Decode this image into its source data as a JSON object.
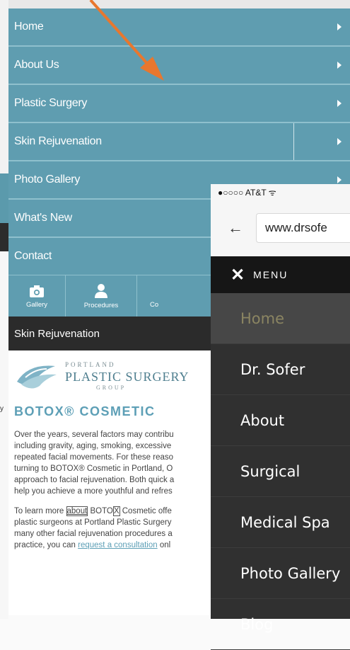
{
  "old_site": {
    "menu_items": [
      {
        "label": "Home"
      },
      {
        "label": "About Us"
      },
      {
        "label": "Plastic Surgery"
      },
      {
        "label": "Skin Rejuvenation"
      },
      {
        "label": "Photo Gallery"
      },
      {
        "label": "What's New"
      },
      {
        "label": "Contact"
      }
    ],
    "icon_bar": [
      {
        "label": "Gallery",
        "icon": "camera-icon"
      },
      {
        "label": "Procedures",
        "icon": "person-icon"
      },
      {
        "label": "Co",
        "icon": "contact-icon"
      }
    ],
    "section_title": "Skin Rejuvenation",
    "logo": {
      "line1": "PORTLAND",
      "line2": "PLASTIC SURGERY",
      "line3": "GROUP"
    },
    "heading": "BOTOX® COSMETIC",
    "para1_lines": [
      "Over the years, several factors may contribu",
      "including gravity, aging, smoking, excessive",
      "repeated facial movements. For these reaso",
      "turning to BOTOX® Cosmetic in Portland, O",
      "approach to facial rejuvenation. Both quick a",
      "help you achieve a more youthful and refres"
    ],
    "para2": {
      "l1_pre": "To learn more ",
      "l1_boxed": "about",
      "l1_mid": " BOTO",
      "l1_boxed2": "X",
      "l1_post": " Cosmetic offe",
      "l2": "plastic surgeons at Portland Plastic Surgery",
      "l3": "many other facial rejuvenation procedures a",
      "l4_pre": "practice, you can ",
      "l4_link": "request a consultation",
      "l4_post": " onl"
    },
    "stray_char": "y"
  },
  "new_site": {
    "status_bar": "●○○○○ AT&T ᯤ",
    "back_arrow": "←",
    "url": "www.drsofe",
    "menu_close": "✕",
    "menu_title": "MENU",
    "nav_items": [
      {
        "label": "Home",
        "active": true
      },
      {
        "label": "Dr. Sofer",
        "active": false
      },
      {
        "label": "About",
        "active": false
      },
      {
        "label": "Surgical",
        "active": false
      },
      {
        "label": "Medical Spa",
        "active": false
      },
      {
        "label": "Photo Gallery",
        "active": false
      },
      {
        "label": "Blog",
        "active": false
      }
    ]
  },
  "colors": {
    "old_menu_bg": "#5f9db0",
    "arrow": "#e8772e",
    "new_menu_bg": "#303030",
    "active_item_text": "#8b8562"
  }
}
